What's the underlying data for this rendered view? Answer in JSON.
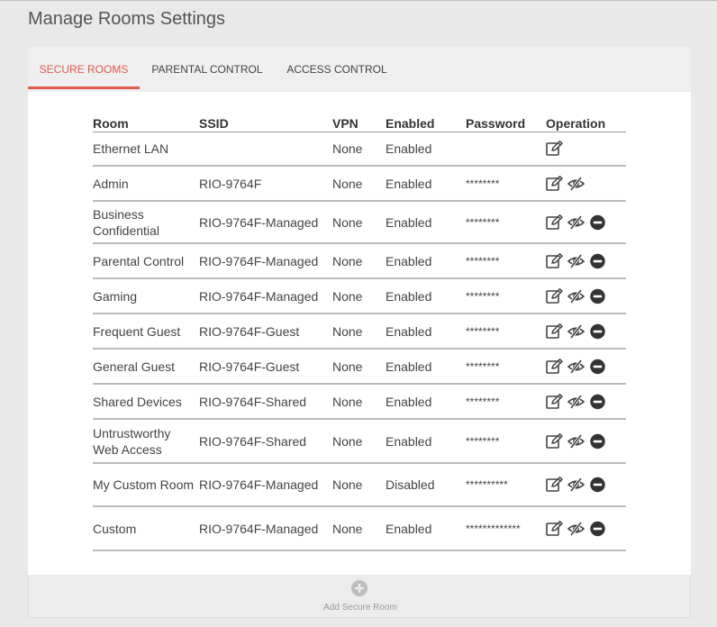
{
  "page": {
    "title": "Manage Rooms Settings"
  },
  "tabs": [
    {
      "label": "SECURE ROOMS",
      "active": true
    },
    {
      "label": "PARENTAL CONTROL",
      "active": false
    },
    {
      "label": "ACCESS CONTROL",
      "active": false
    }
  ],
  "table": {
    "headers": {
      "room": "Room",
      "ssid": "SSID",
      "vpn": "VPN",
      "enabled": "Enabled",
      "password": "Password",
      "operation": "Operation"
    },
    "rows": [
      {
        "room": "Ethernet LAN",
        "ssid": "",
        "vpn": "None",
        "enabled": "Enabled",
        "password": "",
        "ops": [
          "edit"
        ]
      },
      {
        "room": "Admin",
        "ssid": "RIO-9764F",
        "vpn": "None",
        "enabled": "Enabled",
        "password": "********",
        "ops": [
          "edit",
          "show-password"
        ]
      },
      {
        "room": "Business Confidential",
        "ssid": "RIO-9764F-Managed",
        "vpn": "None",
        "enabled": "Enabled",
        "password": "********",
        "ops": [
          "edit",
          "show-password",
          "delete"
        ]
      },
      {
        "room": "Parental Control",
        "ssid": "RIO-9764F-Managed",
        "vpn": "None",
        "enabled": "Enabled",
        "password": "********",
        "ops": [
          "edit",
          "show-password",
          "delete"
        ]
      },
      {
        "room": "Gaming",
        "ssid": "RIO-9764F-Managed",
        "vpn": "None",
        "enabled": "Enabled",
        "password": "********",
        "ops": [
          "edit",
          "show-password",
          "delete"
        ]
      },
      {
        "room": "Frequent Guest",
        "ssid": "RIO-9764F-Guest",
        "vpn": "None",
        "enabled": "Enabled",
        "password": "********",
        "ops": [
          "edit",
          "show-password",
          "delete"
        ]
      },
      {
        "room": "General Guest",
        "ssid": "RIO-9764F-Guest",
        "vpn": "None",
        "enabled": "Enabled",
        "password": "********",
        "ops": [
          "edit",
          "show-password",
          "delete"
        ]
      },
      {
        "room": "Shared Devices",
        "ssid": "RIO-9764F-Shared",
        "vpn": "None",
        "enabled": "Enabled",
        "password": "********",
        "ops": [
          "edit",
          "show-password",
          "delete"
        ]
      },
      {
        "room": "Untrustworthy Web Access",
        "ssid": "RIO-9764F-Shared",
        "vpn": "None",
        "enabled": "Enabled",
        "password": "********",
        "ops": [
          "edit",
          "show-password",
          "delete"
        ]
      },
      {
        "room": "My Custom Room",
        "ssid": "RIO-9764F-Managed",
        "vpn": "None",
        "enabled": "Disabled",
        "password": "**********",
        "ops": [
          "edit",
          "show-password",
          "delete"
        ]
      },
      {
        "room": "Custom",
        "ssid": "RIO-9764F-Managed",
        "vpn": "None",
        "enabled": "Enabled",
        "password": "*************",
        "ops": [
          "edit",
          "show-password",
          "delete"
        ]
      }
    ]
  },
  "add_room": {
    "label": "Add Secure Room",
    "icon": "plus-circle-icon"
  },
  "icons": {
    "edit": "edit-icon",
    "show-password": "eye-slash-icon",
    "delete": "minus-circle-icon"
  },
  "colors": {
    "accent": "#e05a4e",
    "background": "#e9e9e9",
    "panel": "#ffffff",
    "tabbar": "#efefef"
  }
}
